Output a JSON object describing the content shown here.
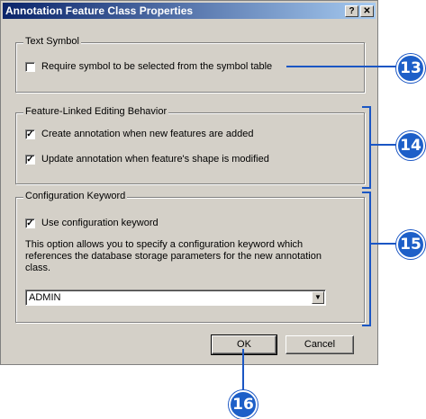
{
  "window": {
    "title": "Annotation Feature Class Properties",
    "help_button": "?",
    "close_button": "✕"
  },
  "text_symbol": {
    "legend": "Text Symbol",
    "require_symbol_label": "Require symbol to be selected from the symbol table",
    "require_symbol_checked": false
  },
  "editing_behavior": {
    "legend": "Feature-Linked Editing Behavior",
    "create_label": "Create annotation when new features are added",
    "create_checked": true,
    "update_label": "Update annotation when feature's shape is modified",
    "update_checked": true
  },
  "config_keyword": {
    "legend": "Configuration Keyword",
    "use_label": "Use configuration keyword",
    "use_checked": true,
    "description": "This option allows you to specify a configuration keyword which references the database storage parameters for the new annotation class.",
    "keyword_value": "ADMIN"
  },
  "buttons": {
    "ok": "OK",
    "cancel": "Cancel"
  },
  "callouts": [
    "13",
    "14",
    "15",
    "16"
  ],
  "colors": {
    "callout": "#1d5fc8",
    "titlebar_start": "#0a246a",
    "titlebar_end": "#a6caf0",
    "dialog_bg": "#d4d0c8"
  }
}
